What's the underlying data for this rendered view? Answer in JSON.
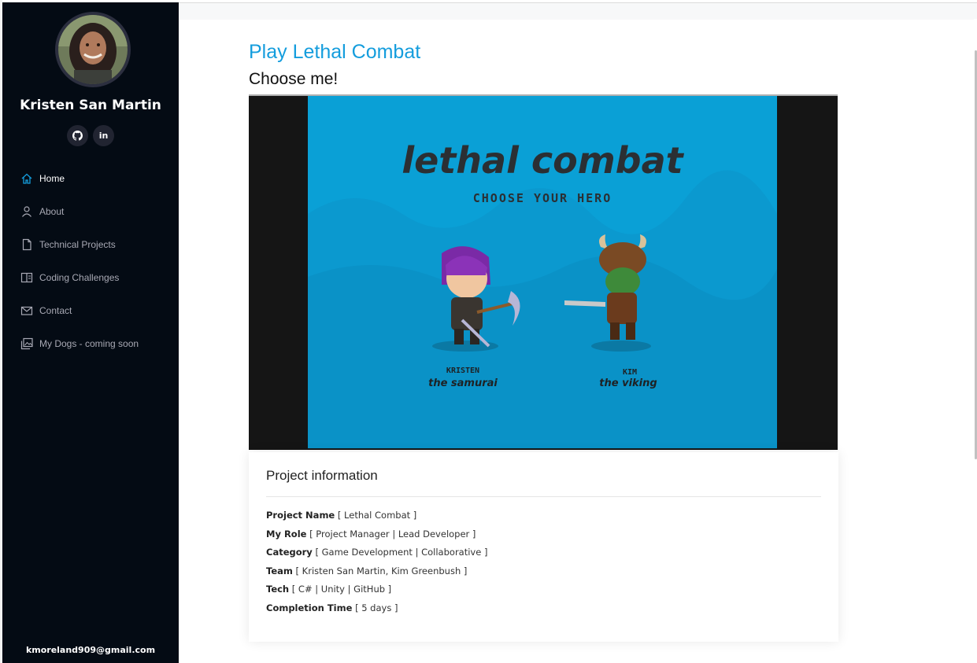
{
  "sidebar": {
    "name": "Kristen San Martin",
    "social": [
      {
        "icon": "github-icon",
        "label": ""
      },
      {
        "icon": "linkedin-icon",
        "label": "in"
      }
    ],
    "nav": [
      {
        "label": "Home",
        "icon": "home-icon",
        "active": true
      },
      {
        "label": "About",
        "icon": "user-icon",
        "active": false
      },
      {
        "label": "Technical Projects",
        "icon": "file-icon",
        "active": false
      },
      {
        "label": "Coding Challenges",
        "icon": "book-icon",
        "active": false
      },
      {
        "label": "Contact",
        "icon": "envelope-icon",
        "active": false
      },
      {
        "label": "My Dogs - coming soon",
        "icon": "images-icon",
        "active": false
      }
    ],
    "email": "kmoreland909@gmail.com"
  },
  "main": {
    "title": "Play Lethal Combat",
    "subtitle": "Choose me!",
    "game": {
      "logo": "lethal combat",
      "tagline": "CHOOSE YOUR HERO",
      "heroes": [
        {
          "name": "KRISTEN",
          "title": "the samurai"
        },
        {
          "name": "KIM",
          "title": "the viking"
        }
      ]
    },
    "info": {
      "heading": "Project information",
      "rows": [
        {
          "label": "Project Name",
          "value": "[ Lethal Combat ]"
        },
        {
          "label": "My Role",
          "value": "[ Project Manager | Lead Developer ]"
        },
        {
          "label": "Category",
          "value": "[ Game Development | Collaborative ]"
        },
        {
          "label": "Team",
          "value": "[ Kristen San Martin, Kim Greenbush ]"
        },
        {
          "label": "Tech",
          "value": "[ C# | Unity | GitHub ]"
        },
        {
          "label": "Completion Time",
          "value": "[ 5 days ]"
        }
      ]
    }
  },
  "colors": {
    "accent": "#149ddd",
    "sidebar": "#040b14",
    "game_bg": "#0aa0d6"
  }
}
